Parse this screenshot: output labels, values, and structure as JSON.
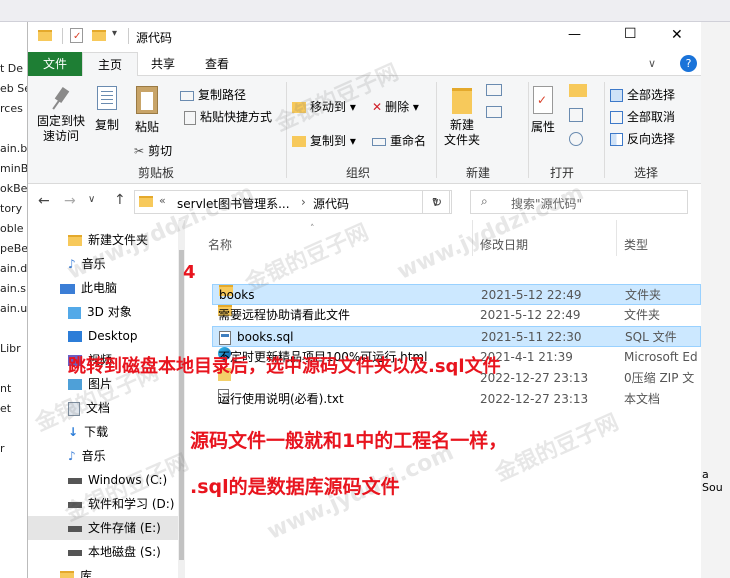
{
  "ide": {
    "left_snippets": [
      "t De",
      "eb Se",
      "rces",
      "",
      "ain.b",
      "minB",
      "okBe",
      "tory",
      "oble",
      "peBe",
      "ain.d",
      "ain.s",
      "ain.u",
      "",
      "Libr",
      "",
      "nt",
      "et",
      "",
      "r"
    ],
    "right_snippet": "a Sou"
  },
  "window": {
    "title": "源代码",
    "min_glyph": "—",
    "max_glyph": "☐",
    "close_glyph": "✕",
    "help_glyph": "?",
    "expand_glyph": "∨"
  },
  "ribbon": {
    "tabs": [
      "文件",
      "主页",
      "共享",
      "查看"
    ],
    "clipboard": {
      "pin": "固定到快\n速访问",
      "copy": "复制",
      "paste": "粘贴",
      "copy_path": "复制路径",
      "paste_shortcut": "粘贴快捷方式",
      "cut": "剪切",
      "label": "剪贴板"
    },
    "organize": {
      "move_to": "移动到",
      "delete": "删除",
      "copy_to": "复制到",
      "rename": "重命名",
      "label": "组织"
    },
    "new": {
      "new_folder": "新建\n文件夹",
      "label": "新建"
    },
    "open": {
      "properties": "属性",
      "label": "打开"
    },
    "select": {
      "select_all": "全部选择",
      "select_none": "全部取消",
      "invert": "反向选择",
      "label": "选择"
    }
  },
  "address": {
    "crumbs": [
      "servlet图书管理系...",
      "源代码"
    ],
    "search_placeholder": "搜索\"源代码\""
  },
  "nav": {
    "items": [
      "新建文件夹",
      "音乐",
      "此电脑",
      "3D 对象",
      "Desktop",
      "视频",
      "图片",
      "文档",
      "下载",
      "音乐",
      "Windows (C:)",
      "软件和学习 (D:)",
      "文件存储 (E:)",
      "本地磁盘 (S:)",
      "库"
    ]
  },
  "list": {
    "headers": {
      "name": "名称",
      "date": "修改日期",
      "type": "类型"
    },
    "rows": [
      {
        "name": "books",
        "date": "2021-5-12 22:49",
        "type": "文件夹"
      },
      {
        "name": "需要远程协助请看此文件",
        "date": "2021-5-12 22:49",
        "type": "文件夹"
      },
      {
        "name": "books.sql",
        "date": "2021-5-11 22:30",
        "type": "SQL 文件"
      },
      {
        "name": "不定时更新精品项目100%可运行.html",
        "date": "2021-4-1 21:39",
        "type": "Microsoft Ed"
      },
      {
        "name": "",
        "date": "2022-12-27 23:13",
        "type": "0压缩 ZIP 文"
      },
      {
        "name": "运行使用说明(必看).txt",
        "date": "2022-12-27 23:13",
        "type": "本文档"
      }
    ]
  },
  "annotations": {
    "step": "4",
    "line1": "跳转到磁盘本地目录后，选中源码文件夹以及.sql文件",
    "line2": "源码文件一般就和1中的工程名一样，",
    "line3": ".sql的是数据库源码文件"
  },
  "watermark": {
    "cn": "金银的豆子网",
    "url": "www.jyddzi.com"
  },
  "colors": {
    "file_tab": "#1e7e34",
    "selection": "#cce8ff",
    "annotation": "#e8141e"
  }
}
